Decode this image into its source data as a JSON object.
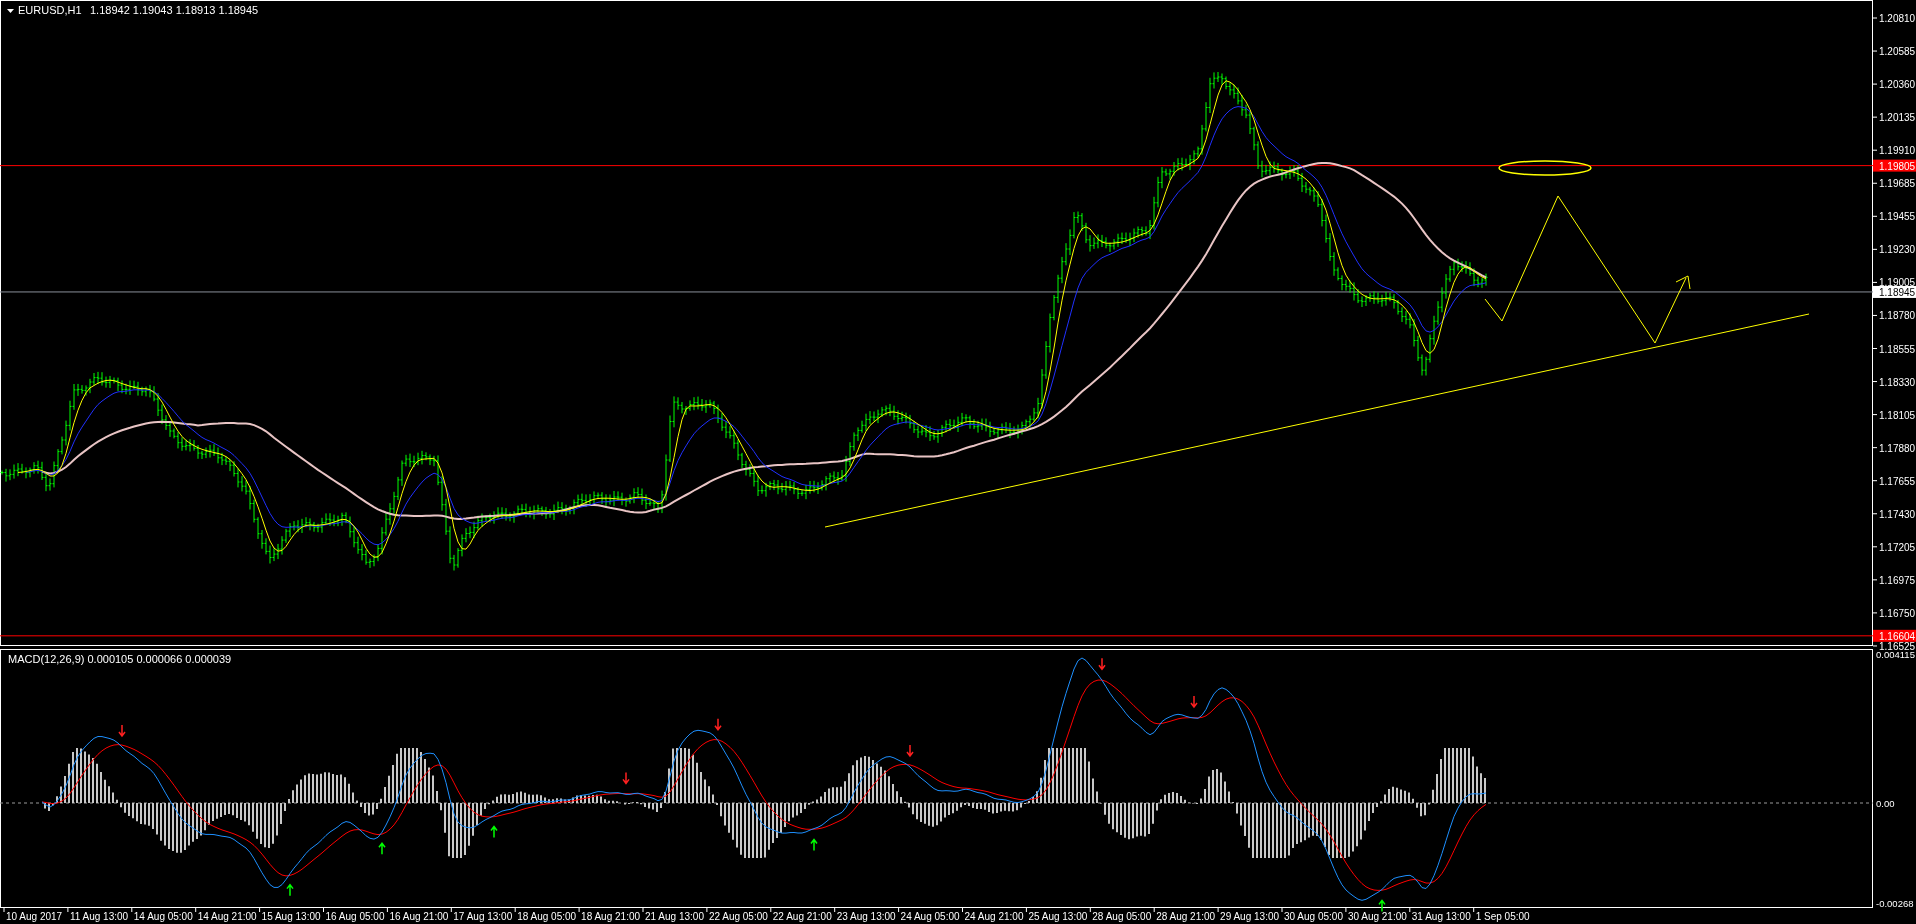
{
  "header": {
    "symbol": "EURUSD,H1",
    "quote": "1.18942 1.19043 1.18913 1.18945"
  },
  "price_axis": [
    "1.20810",
    "1.20585",
    "1.20360",
    "1.20135",
    "1.19910",
    "1.19685",
    "1.19455",
    "1.19230",
    "1.19005",
    "1.18780",
    "1.18555",
    "1.18330",
    "1.18105",
    "1.17880",
    "1.17655",
    "1.17430",
    "1.17205",
    "1.16975",
    "1.16750",
    "1.16525"
  ],
  "price_tags": [
    {
      "label": "1.19805",
      "kind": "level",
      "color": "#ff0000"
    },
    {
      "label": "1.18945",
      "kind": "bid"
    },
    {
      "label": "1.16604",
      "kind": "level",
      "color": "#ff0000"
    }
  ],
  "indicator": {
    "title": "MACD(12,26,9) 0.000105 0.000066 0.000039",
    "axis": [
      "0.004115",
      "0.00",
      "-0.00268"
    ]
  },
  "time_axis": [
    "10 Aug 2017",
    "11 Aug 13:00",
    "14 Aug 05:00",
    "14 Aug 21:00",
    "15 Aug 13:00",
    "16 Aug 05:00",
    "16 Aug 21:00",
    "17 Aug 13:00",
    "18 Aug 05:00",
    "18 Aug 21:00",
    "21 Aug 13:00",
    "22 Aug 05:00",
    "22 Aug 21:00",
    "23 Aug 13:00",
    "24 Aug 05:00",
    "24 Aug 21:00",
    "25 Aug 13:00",
    "28 Aug 05:00",
    "28 Aug 21:00",
    "29 Aug 13:00",
    "30 Aug 05:00",
    "30 Aug 21:00",
    "31 Aug 13:00",
    "1 Sep 05:00"
  ]
}
